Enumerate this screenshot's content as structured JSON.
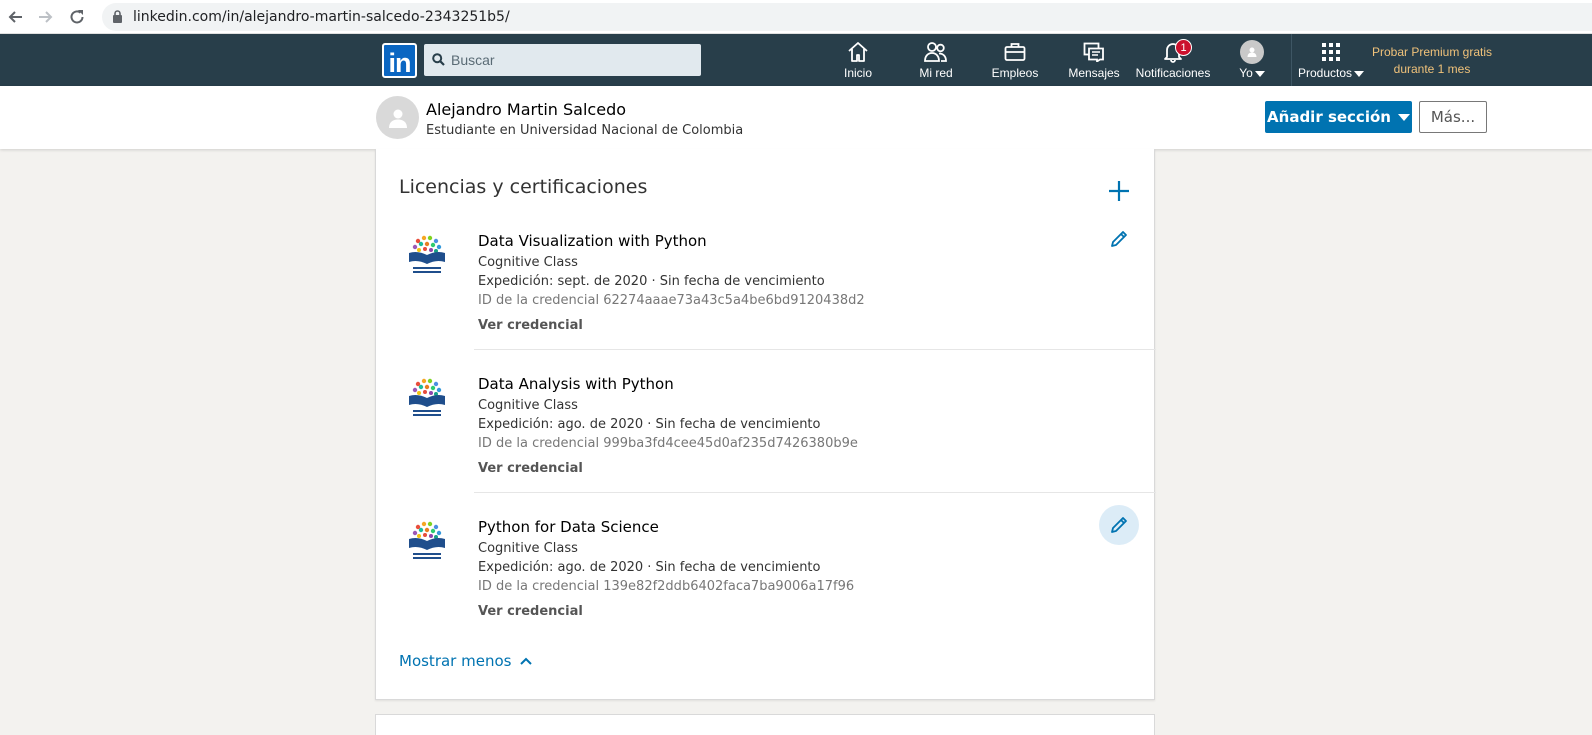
{
  "browser": {
    "url": "linkedin.com/in/alejandro-martin-salcedo-2343251b5/"
  },
  "nav": {
    "search_placeholder": "Buscar",
    "items": [
      {
        "label": "Inicio",
        "icon": "home-icon"
      },
      {
        "label": "Mi red",
        "icon": "network-icon"
      },
      {
        "label": "Empleos",
        "icon": "briefcase-icon"
      },
      {
        "label": "Mensajes",
        "icon": "messages-icon"
      },
      {
        "label": "Notificaciones",
        "icon": "bell-icon",
        "badge": "1"
      },
      {
        "label": "Yo",
        "icon": "avatar-icon"
      },
      {
        "label": "Productos",
        "icon": "grid-icon"
      }
    ],
    "premium_line1": "Probar Premium gratis",
    "premium_line2": "durante 1 mes"
  },
  "profile": {
    "name": "Alejandro Martin Salcedo",
    "headline": "Estudiante en Universidad Nacional de Colombia",
    "add_section_label": "Añadir sección",
    "more_label": "Más..."
  },
  "section": {
    "title": "Licencias y certificaciones",
    "certs": [
      {
        "title": "Data Visualization with Python",
        "issuer": "Cognitive Class",
        "issued": "Expedición: sept. de 2020 · Sin fecha de vencimiento",
        "credential": "ID de la credencial 62274aaae73a43c5a4be6bd9120438d2",
        "link": "Ver credencial"
      },
      {
        "title": "Data Analysis with Python",
        "issuer": "Cognitive Class",
        "issued": "Expedición: ago. de 2020 · Sin fecha de vencimiento",
        "credential": "ID de la credencial 999ba3fd4cee45d0af235d7426380b9e",
        "link": "Ver credencial"
      },
      {
        "title": "Python for Data Science",
        "issuer": "Cognitive Class",
        "issued": "Expedición: ago. de 2020 · Sin fecha de vencimiento",
        "credential": "ID de la credencial 139e82f2ddb6402faca7ba9006a17f96",
        "link": "Ver credencial"
      }
    ],
    "show_less_label": "Mostrar menos"
  },
  "colors": {
    "nav_bg": "#283e4a",
    "brand_blue": "#0073b1",
    "premium_gold": "#f0c27a",
    "badge_red": "#cb112d"
  }
}
